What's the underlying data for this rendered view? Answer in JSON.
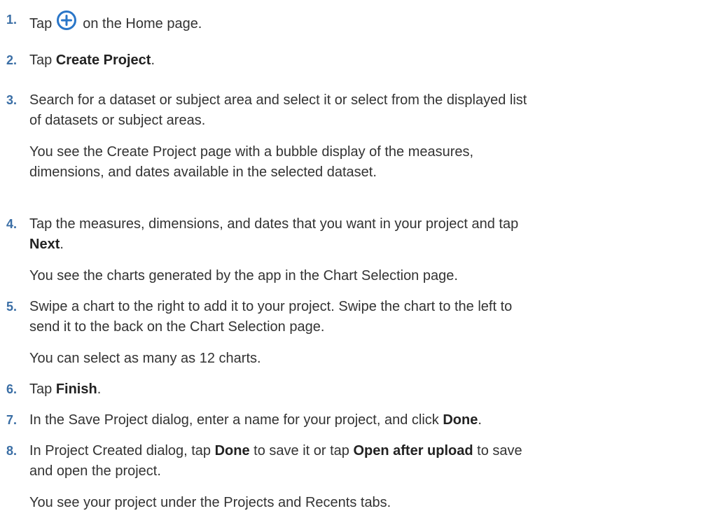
{
  "steps": [
    {
      "number": "1.",
      "pre": "Tap",
      "icon": "plus-circle-icon",
      "post": "on the Home page."
    },
    {
      "number": "2.",
      "pre": "Tap ",
      "bold": "Create Project",
      "post": "."
    },
    {
      "number": "3.",
      "line1": "Search for a dataset or subject area and select it or select from the displayed list",
      "line2": "of datasets or subject areas.",
      "note1": "You see the Create Project page with a bubble display of the measures,",
      "note2": "dimensions, and dates available in the selected dataset."
    },
    {
      "number": "4.",
      "line1": "Tap the measures, dimensions, and dates that you want in your project and tap",
      "bold": "Next",
      "post": ".",
      "note": "You see the charts generated by the app in the Chart Selection page."
    },
    {
      "number": "5.",
      "line1": "Swipe a chart to the right to add it to your project. Swipe the chart to the left to",
      "line2": "send it to the back on the Chart Selection page.",
      "note": "You can select as many as 12 charts."
    },
    {
      "number": "6.",
      "pre": "Tap ",
      "bold": "Finish",
      "post": "."
    },
    {
      "number": "7.",
      "pre": "In the Save Project dialog, enter a name for your project, and click ",
      "bold": "Done",
      "post": "."
    },
    {
      "number": "8.",
      "pre": "In Project Created dialog, tap ",
      "bold": "Done",
      "mid": " to save it or tap ",
      "bold2": "Open after upload",
      "post_line1": " to save",
      "line2": "and open the project.",
      "note": "You see your project under the Projects and Recents tabs."
    }
  ],
  "colors": {
    "number": "#3a6ea5",
    "icon": "#2a76c8",
    "text": "#333333"
  }
}
